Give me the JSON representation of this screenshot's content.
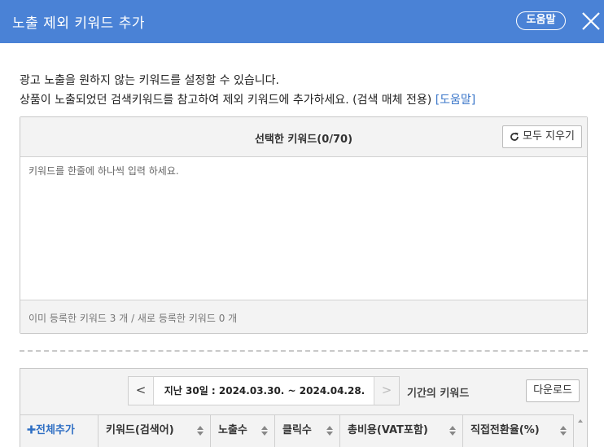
{
  "header": {
    "title": "노출 제외 키워드 추가",
    "help_label": "도움말"
  },
  "description": {
    "line1": "광고 노출을 원하지 않는 키워드를 설정할 수 있습니다.",
    "line2_prefix": "상품이 노출되었던 검색키워드를 참고하여 제외 키워드에 추가하세요. (검색 매체 전용) ",
    "line2_link_open": "[",
    "line2_link": "도움말",
    "line2_link_close": "]"
  },
  "keyword_box": {
    "title": "선택한 키워드(0/70)",
    "clear_label": "모두 지우기",
    "placeholder": "키워드를 한줄에 하나씩 입력 하세요.",
    "value": "",
    "footer": "이미 등록한 키워드 3 개 / 새로 등록한 키워드 0 개"
  },
  "table_section": {
    "prev_label": "<",
    "next_label": ">",
    "period_text": "지난 30일 : 2024.03.30. ~ 2024.04.28.",
    "period_suffix": "기간의 키워드",
    "download_label": "다운로드",
    "add_all_label": "전체추가",
    "columns": [
      "키워드(검색어)",
      "노출수",
      "클릭수",
      "총비용(VAT포함)",
      "직접전환율(%)"
    ]
  },
  "colors": {
    "header_bg": "#4a82d6",
    "link": "#3a76c9",
    "panel_bg": "#f3f3f3"
  }
}
